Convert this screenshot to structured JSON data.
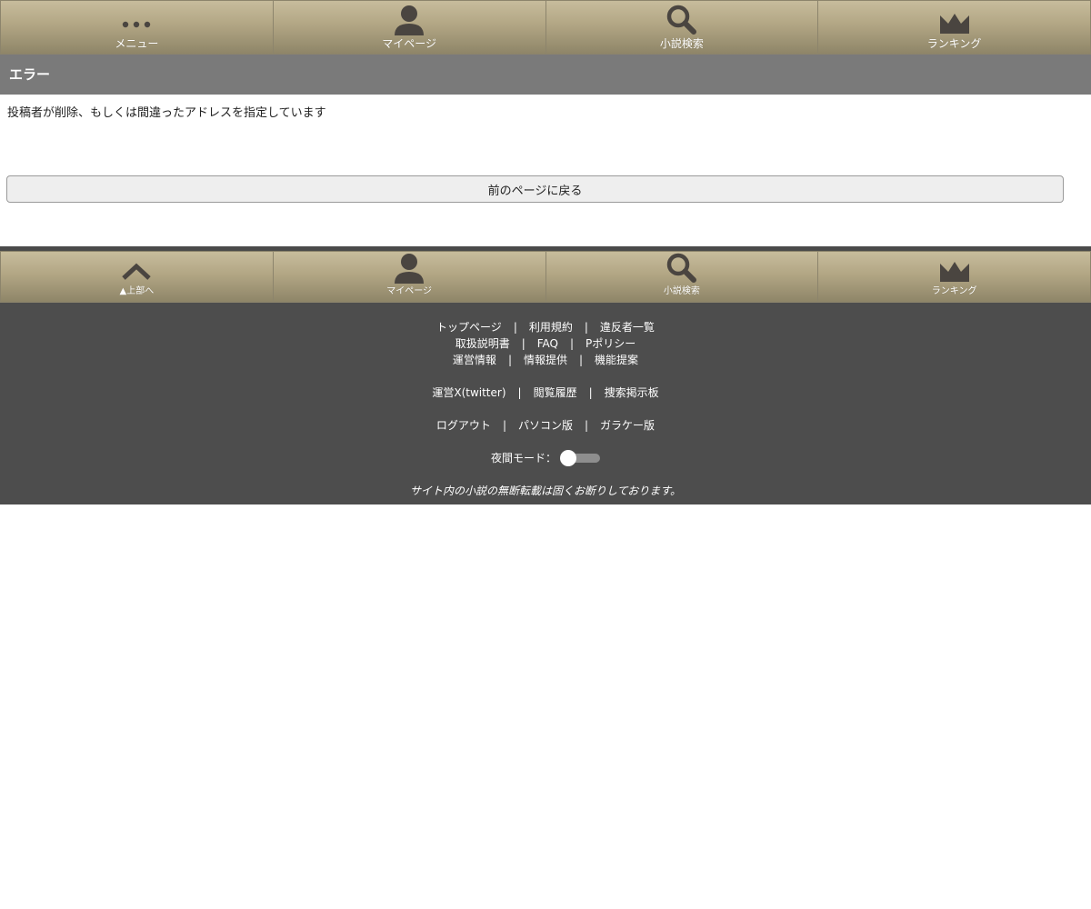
{
  "top_nav": {
    "items": [
      {
        "label": "メニュー",
        "icon": "dots-icon"
      },
      {
        "label": "マイページ",
        "icon": "user-icon"
      },
      {
        "label": "小説検索",
        "icon": "search-icon"
      },
      {
        "label": "ランキング",
        "icon": "crown-icon"
      }
    ]
  },
  "error": {
    "title": "エラー",
    "message": "投稿者が削除、もしくは間違ったアドレスを指定しています",
    "back_button": "前のページに戻る"
  },
  "bottom_nav": {
    "items": [
      {
        "label": "▲上部へ",
        "icon": "chevron-up-icon"
      },
      {
        "label": "マイページ",
        "icon": "user-icon"
      },
      {
        "label": "小説検索",
        "icon": "search-icon"
      },
      {
        "label": "ランキング",
        "icon": "crown-icon"
      }
    ]
  },
  "footer": {
    "separator": "|",
    "line1": [
      "トップページ",
      "利用規約",
      "違反者一覧"
    ],
    "line2": [
      "取扱説明書",
      "FAQ",
      "Pポリシー"
    ],
    "line3": [
      "運営情報",
      "情報提供",
      "機能提案"
    ],
    "line4": [
      "運営X(twitter)",
      "閲覧履歴",
      "捜索掲示板"
    ],
    "line5": [
      "ログアウト",
      "パソコン版",
      "ガラケー版"
    ],
    "night_mode_label": "夜間モード：",
    "night_mode_on": false,
    "notice": "サイト内の小説の無断転載は固くお断りしております。"
  },
  "colors": {
    "nav_gradient_top": "#c7bc9c",
    "nav_gradient_bottom": "#8e8568",
    "icon": "#4a4540",
    "error_header_bg": "#7a7a7a",
    "footer_bg": "#4d4d4d"
  }
}
